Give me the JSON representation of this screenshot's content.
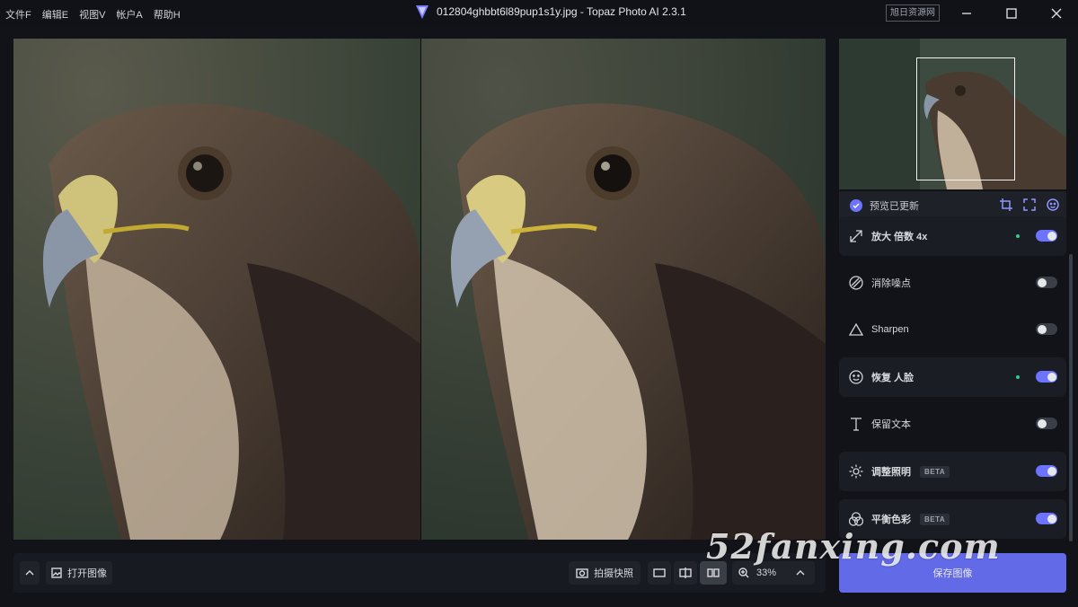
{
  "menu": [
    "文件F",
    "编辑E",
    "视图V",
    "帐户A",
    "帮助H"
  ],
  "window": {
    "title": "012804ghbbt6l89pup1s1y.jpg - Topaz Photo AI 2.3.1",
    "badge": "旭日资源网"
  },
  "toolbar": {
    "open_image": "打开图像",
    "snapshot": "拍摄快照",
    "zoom": "33%"
  },
  "preview": {
    "status": "预览已更新"
  },
  "models": [
    {
      "label": "放大 倍数 4x",
      "icon": "upscale-icon",
      "enabled": true,
      "dot": true,
      "beta": false
    },
    {
      "label": "消除噪点",
      "icon": "denoise-icon",
      "enabled": false,
      "dot": false,
      "beta": false
    },
    {
      "label": "Sharpen",
      "icon": "sharpen-icon",
      "enabled": false,
      "dot": false,
      "beta": false
    },
    {
      "label": "恢复 人脸",
      "icon": "face-icon",
      "enabled": true,
      "dot": true,
      "beta": false
    },
    {
      "label": "保留文本",
      "icon": "text-icon",
      "enabled": false,
      "dot": false,
      "beta": false
    },
    {
      "label": "调整照明",
      "icon": "sun-icon",
      "enabled": true,
      "dot": false,
      "beta": true
    },
    {
      "label": "平衡色彩",
      "icon": "color-balance-icon",
      "enabled": true,
      "dot": false,
      "beta": true
    }
  ],
  "beta_label": "BETA",
  "save_label": "保存图像",
  "site_watermark": "52fanxing.com",
  "colors": {
    "accent": "#6c74ff",
    "active_dot": "#2fcf8b",
    "background": "#111319"
  }
}
